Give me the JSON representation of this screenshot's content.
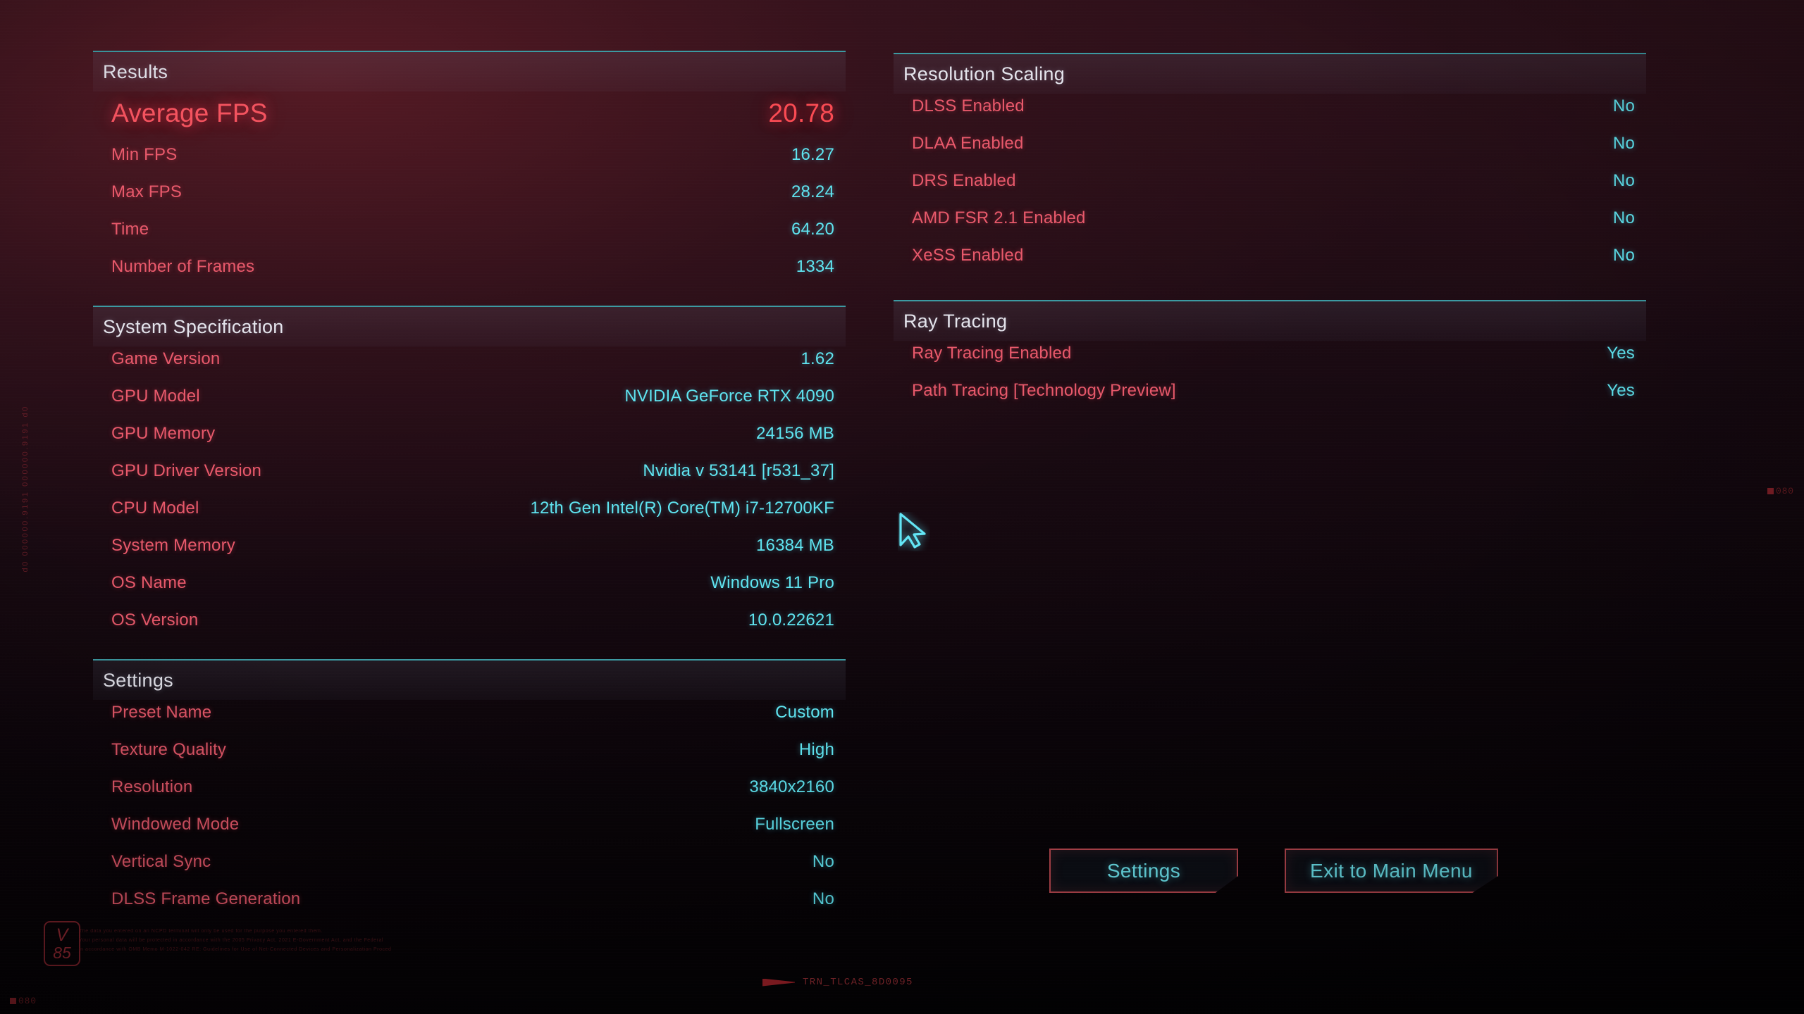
{
  "screen": {
    "accent_cyan": "#5fe4f0",
    "accent_red": "#e8596b",
    "header_line": "#3c9aa2",
    "hero_red": "#fb4b53"
  },
  "left_column": {
    "sections": [
      {
        "title": "Results",
        "rows": [
          {
            "label": "Average FPS",
            "value": "20.78",
            "hero": true
          },
          {
            "label": "Min FPS",
            "value": "16.27"
          },
          {
            "label": "Max FPS",
            "value": "28.24"
          },
          {
            "label": "Time",
            "value": "64.20"
          },
          {
            "label": "Number of Frames",
            "value": "1334"
          }
        ]
      },
      {
        "title": "System Specification",
        "rows": [
          {
            "label": "Game Version",
            "value": "1.62"
          },
          {
            "label": "GPU Model",
            "value": "NVIDIA GeForce RTX 4090"
          },
          {
            "label": "GPU Memory",
            "value": "24156 MB"
          },
          {
            "label": "GPU Driver Version",
            "value": "Nvidia v 53141 [r531_37]"
          },
          {
            "label": "CPU Model",
            "value": "12th Gen Intel(R) Core(TM) i7-12700KF"
          },
          {
            "label": "System Memory",
            "value": "16384 MB"
          },
          {
            "label": "OS Name",
            "value": "Windows 11 Pro"
          },
          {
            "label": "OS Version",
            "value": "10.0.22621"
          }
        ]
      },
      {
        "title": "Settings",
        "rows": [
          {
            "label": "Preset Name",
            "value": "Custom"
          },
          {
            "label": "Texture Quality",
            "value": "High"
          },
          {
            "label": "Resolution",
            "value": "3840x2160"
          },
          {
            "label": "Windowed Mode",
            "value": "Fullscreen"
          },
          {
            "label": "Vertical Sync",
            "value": "No"
          },
          {
            "label": "DLSS Frame Generation",
            "value": "No"
          }
        ]
      }
    ]
  },
  "right_column": {
    "sections": [
      {
        "title": "Resolution Scaling",
        "rows": [
          {
            "label": "DLSS Enabled",
            "value": "No"
          },
          {
            "label": "DLAA Enabled",
            "value": "No"
          },
          {
            "label": "DRS Enabled",
            "value": "No"
          },
          {
            "label": "AMD FSR 2.1 Enabled",
            "value": "No"
          },
          {
            "label": "XeSS Enabled",
            "value": "No"
          }
        ]
      },
      {
        "title": "Ray Tracing",
        "rows": [
          {
            "label": "Ray Tracing Enabled",
            "value": "Yes"
          },
          {
            "label": "Path Tracing [Technology Preview]",
            "value": "Yes"
          }
        ]
      }
    ]
  },
  "buttons": {
    "settings_label": "Settings",
    "exit_label": "Exit to Main Menu"
  },
  "chrome": {
    "badge_letter": "V",
    "badge_number": "85",
    "legal_line_1": "The data you entered on an NCPD terminal will only be used for the purpose you entered them.",
    "legal_line_2": "Your personal data will be protected in accordance with the 2005 Privacy Act, 2021 E-Government Act, and the Federal",
    "legal_line_3": "in accordance with OMB Memo M-1022-042 RE: Guidelines for Use of Net-Connected Devices and Personalization Proced",
    "left_rail_text": "d0 000000.9191 000000.9191 d0",
    "footer_code": "TRN_TLCAS_8D0095",
    "corner_mark_right": "080",
    "corner_mark_bottom": "080"
  }
}
